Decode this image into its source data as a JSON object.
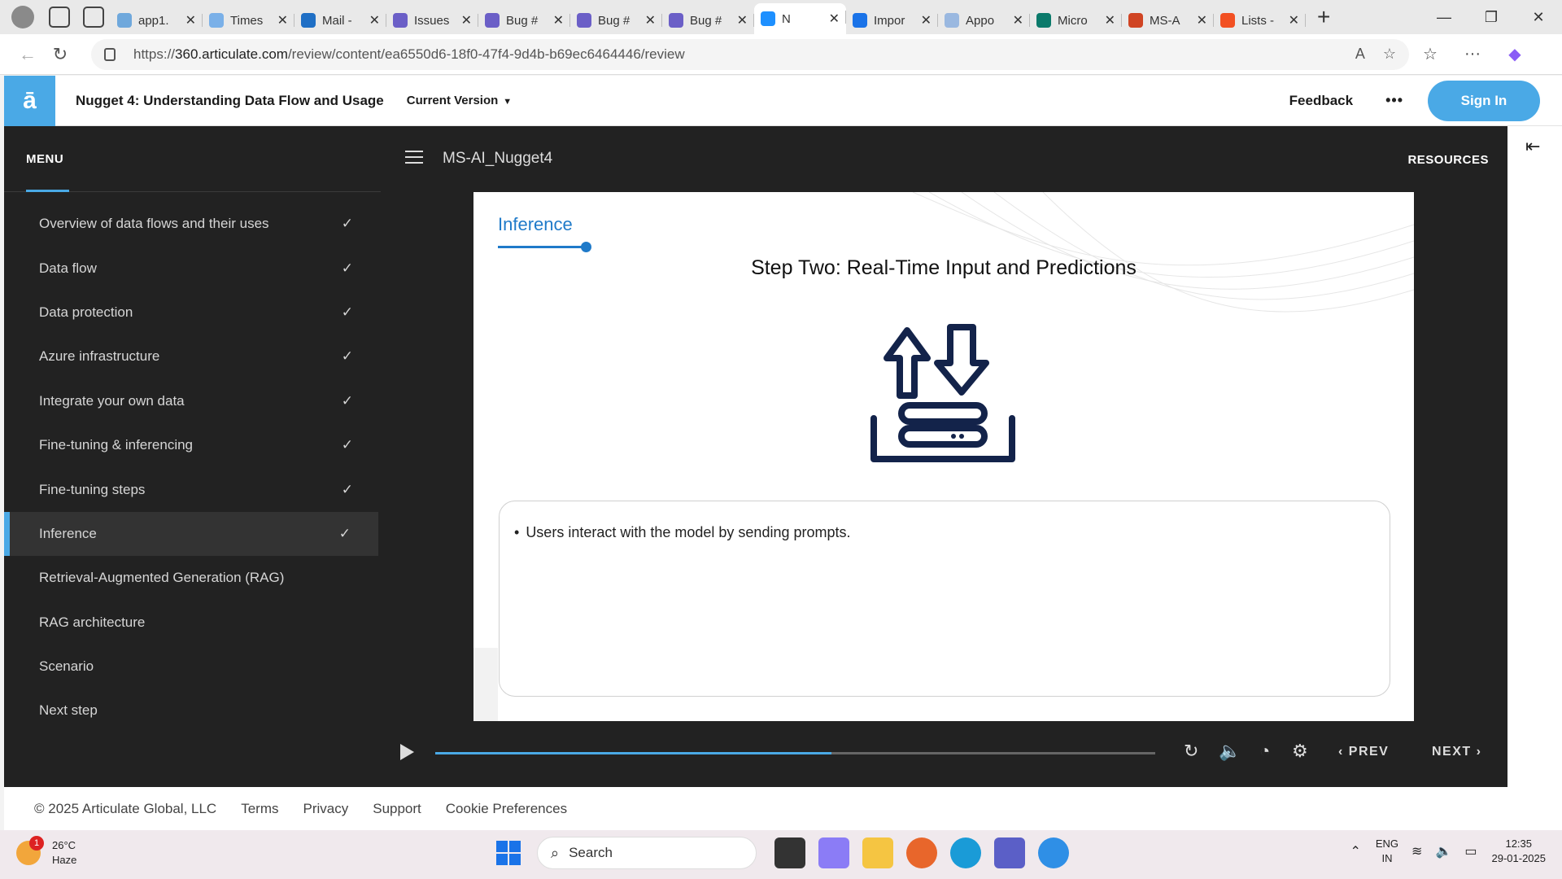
{
  "browser": {
    "tabs": [
      {
        "title": "app1.",
        "color": "#6fa8dc"
      },
      {
        "title": "Times",
        "color": "#7ab0e8"
      },
      {
        "title": "Mail -",
        "color": "#1f6fc5"
      },
      {
        "title": "Issues",
        "color": "#6b5fc7"
      },
      {
        "title": "Bug #",
        "color": "#6b5fc7"
      },
      {
        "title": "Bug #",
        "color": "#6b5fc7"
      },
      {
        "title": "Bug #",
        "color": "#6b5fc7"
      },
      {
        "title": "N",
        "color": "#1e90ff"
      },
      {
        "title": "Impor",
        "color": "#1a73e8"
      },
      {
        "title": "Appo",
        "color": "#9ab8e0"
      },
      {
        "title": "Micro",
        "color": "#0b7a6b"
      },
      {
        "title": "MS-A",
        "color": "#d04423"
      },
      {
        "title": "Lists -",
        "color": "#f25022"
      }
    ],
    "url": {
      "scheme": "https://",
      "host": "360.articulate.com",
      "path": "/review/content/ea6550d6-18f0-47f4-9d4b-b69ec6464446/review"
    }
  },
  "header": {
    "logo": "ā",
    "course_title": "Nugget 4: Understanding Data Flow and Usage",
    "version_label": "Current Version",
    "feedback_label": "Feedback",
    "more_label": "•••",
    "signin_label": "Sign In"
  },
  "sidebar": {
    "menu_label": "MENU",
    "items": [
      {
        "label": "Overview of data flows and their uses",
        "checked": true
      },
      {
        "label": "Data flow",
        "checked": true
      },
      {
        "label": "Data protection",
        "checked": true
      },
      {
        "label": "Azure infrastructure",
        "checked": true
      },
      {
        "label": "Integrate your own data",
        "checked": true
      },
      {
        "label": "Fine-tuning & inferencing",
        "checked": true
      },
      {
        "label": "Fine-tuning steps",
        "checked": true
      },
      {
        "label": "Inference",
        "checked": true,
        "current": true
      },
      {
        "label": "Retrieval-Augmented Generation (RAG)",
        "checked": false
      },
      {
        "label": "RAG architecture",
        "checked": false
      },
      {
        "label": "Scenario",
        "checked": false
      },
      {
        "label": "Next step",
        "checked": false
      }
    ]
  },
  "player": {
    "slide_name": "MS-AI_Nugget4",
    "resources_label": "RESOURCES",
    "progress": 0.55,
    "prev_label": "PREV",
    "next_label": "NEXT"
  },
  "slide": {
    "tag": "Inference",
    "heading": "Step Two: Real-Time Input and Predictions",
    "bullet": "Users interact with the model by sending prompts."
  },
  "footer": {
    "copyright": "© 2025 Articulate Global, LLC",
    "links": [
      "Terms",
      "Privacy",
      "Support",
      "Cookie Preferences"
    ]
  },
  "taskbar": {
    "weather_badge": "1",
    "temperature": "26°C",
    "condition": "Haze",
    "search_label": "Search",
    "lang_top": "ENG",
    "lang_bottom": "IN",
    "time": "12:35",
    "date": "29-01-2025"
  }
}
